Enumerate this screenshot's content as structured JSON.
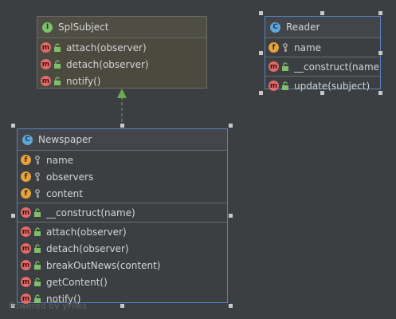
{
  "interface": {
    "title": "SplSubject",
    "members": [
      "attach(observer)",
      "detach(observer)",
      "notify()"
    ]
  },
  "reader": {
    "title": "Reader",
    "fields": [
      "name"
    ],
    "constructors": [
      "__construct(name)"
    ],
    "methods": [
      "update(subject)"
    ]
  },
  "newspaper": {
    "title": "Newspaper",
    "fields": [
      "name",
      "observers",
      "content"
    ],
    "constructors": [
      "__construct(name)"
    ],
    "methods": [
      "attach(observer)",
      "detach(observer)",
      "breakOutNews(content)",
      "getContent()",
      "notify()"
    ]
  },
  "watermark": "Powered by yFiles",
  "icons": {
    "class": "C",
    "interface": "I",
    "field": "f",
    "method": "m"
  },
  "colors": {
    "background": "#3c3f41",
    "selection_border": "#5a7fc0",
    "edge": "#6aa84f"
  }
}
